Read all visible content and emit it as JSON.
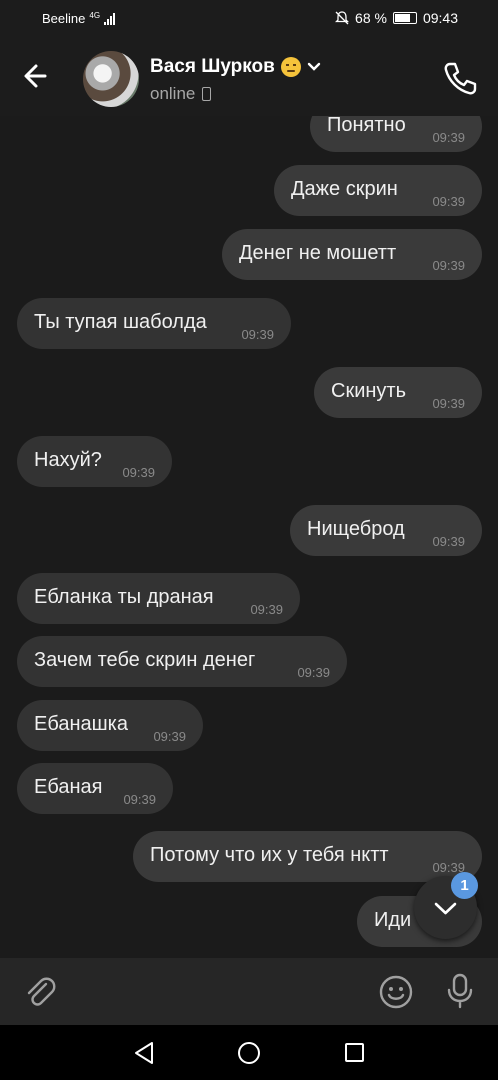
{
  "status_bar": {
    "carrier": "Beeline",
    "network": "4G",
    "battery_percent": "68 %",
    "time": "09:43"
  },
  "header": {
    "contact_name": "Вася Шурков",
    "online_status": "online"
  },
  "messages": [
    {
      "text": "Понятно",
      "time": "09:39",
      "direction": "out"
    },
    {
      "text": "Даже скрин",
      "time": "09:39",
      "direction": "out"
    },
    {
      "text": "Денег не мошетт",
      "time": "09:39",
      "direction": "out"
    },
    {
      "text": "Ты тупая шаболда",
      "time": "09:39",
      "direction": "in"
    },
    {
      "text": "Скинуть",
      "time": "09:39",
      "direction": "out"
    },
    {
      "text": "Нахуй?",
      "time": "09:39",
      "direction": "in"
    },
    {
      "text": "Нищеброд",
      "time": "09:39",
      "direction": "out"
    },
    {
      "text": "Ебланка ты драная",
      "time": "09:39",
      "direction": "in"
    },
    {
      "text": "Зачем тебе скрин денег",
      "time": "09:39",
      "direction": "in"
    },
    {
      "text": "Ебанашка",
      "time": "09:39",
      "direction": "in"
    },
    {
      "text": "Ебаная",
      "time": "09:39",
      "direction": "in"
    },
    {
      "text": "Потому что их у тебя нктт",
      "time": "09:39",
      "direction": "out"
    },
    {
      "text": "Иди",
      "time": "",
      "direction": "out"
    }
  ],
  "scroll_down": {
    "unread_count": "1"
  },
  "colors": {
    "badge": "#5a98e0",
    "bubble": "#3a3a3a",
    "background": "#1b1b1b"
  }
}
